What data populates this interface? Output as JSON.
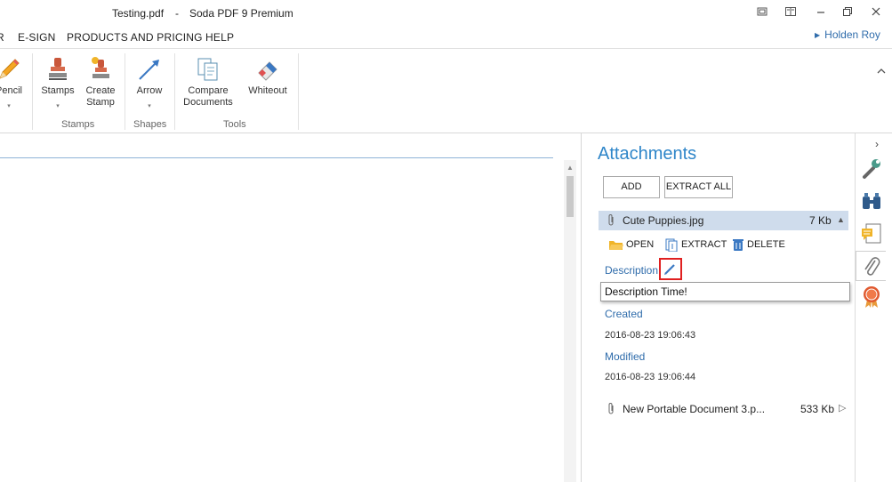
{
  "titlebar": {
    "document": "Testing.pdf",
    "separator": "-",
    "app": "Soda PDF 9 Premium"
  },
  "menu": {
    "items": [
      "R",
      "E-SIGN",
      "PRODUCTS AND PRICING",
      "HELP"
    ],
    "user": "Holden Roy"
  },
  "ribbon": {
    "pencil_label": "Pencil",
    "stamps_label": "Stamps",
    "create_stamp_label": [
      "Create",
      "Stamp"
    ],
    "arrow_label": "Arrow",
    "compare_label": [
      "Compare",
      "Documents"
    ],
    "whiteout_label": "Whiteout",
    "group_stamps": "Stamps",
    "group_shapes": "Shapes",
    "group_tools": "Tools"
  },
  "attachments": {
    "title": "Attachments",
    "add_label": "ADD",
    "extract_all_label": "EXTRACT ALL",
    "items": [
      {
        "name": "Cute Puppies.jpg",
        "size": "7 Kb"
      },
      {
        "name": "New Portable Document 3.p...",
        "size": "533 Kb"
      }
    ],
    "actions": {
      "open": "OPEN",
      "extract": "EXTRACT",
      "delete": "DELETE"
    },
    "description_label": "Description",
    "description_value": "Description Time!",
    "created_label": "Created",
    "created_value": "2016-08-23 19:06:43",
    "modified_label": "Modified",
    "modified_value": "2016-08-23 19:06:44"
  },
  "colors": {
    "accent": "#2f86c9",
    "link": "#2f6cab",
    "selected_row": "#cfdcec",
    "highlight_box": "#e02020"
  },
  "icons": [
    "pencil-icon",
    "stamp-icon",
    "create-stamp-icon",
    "arrow-icon",
    "compare-documents-icon",
    "whiteout-icon",
    "wrench-icon",
    "binoculars-icon",
    "comment-icon",
    "paperclip-icon",
    "ribbon-badge-icon"
  ]
}
